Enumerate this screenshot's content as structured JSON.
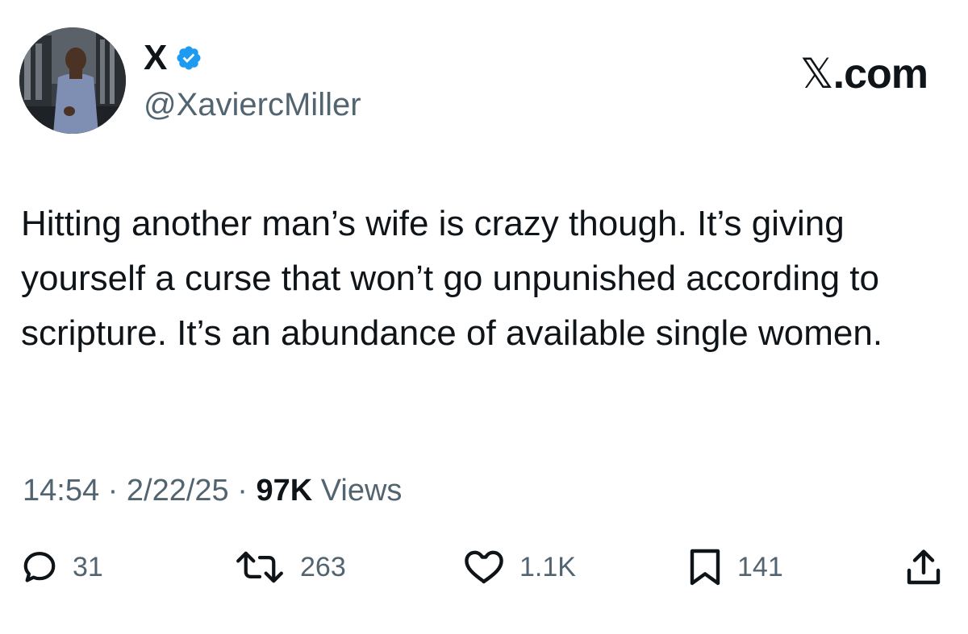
{
  "author": {
    "display_name": "X",
    "handle": "@XaviercMiller",
    "verified": true
  },
  "brand": {
    "mark": "𝕏",
    "suffix": ".com"
  },
  "tweet": {
    "text": "Hitting another man’s wife is crazy though. It’s giving yourself a curse that won’t go unpunished according to scripture. It’s an abundance of available single women."
  },
  "meta": {
    "time": "14:54",
    "date": "2/22/25",
    "views_count": "97K",
    "views_label": "Views",
    "separator": " · "
  },
  "actions": {
    "replies": "31",
    "reposts": "263",
    "likes": "1.1K",
    "bookmarks": "141"
  },
  "colors": {
    "text": "#0f1419",
    "secondary": "#536471",
    "verified": "#1d9bf0"
  },
  "icons": [
    "reply-icon",
    "repost-icon",
    "like-icon",
    "bookmark-icon",
    "share-icon",
    "verified-badge-icon"
  ]
}
